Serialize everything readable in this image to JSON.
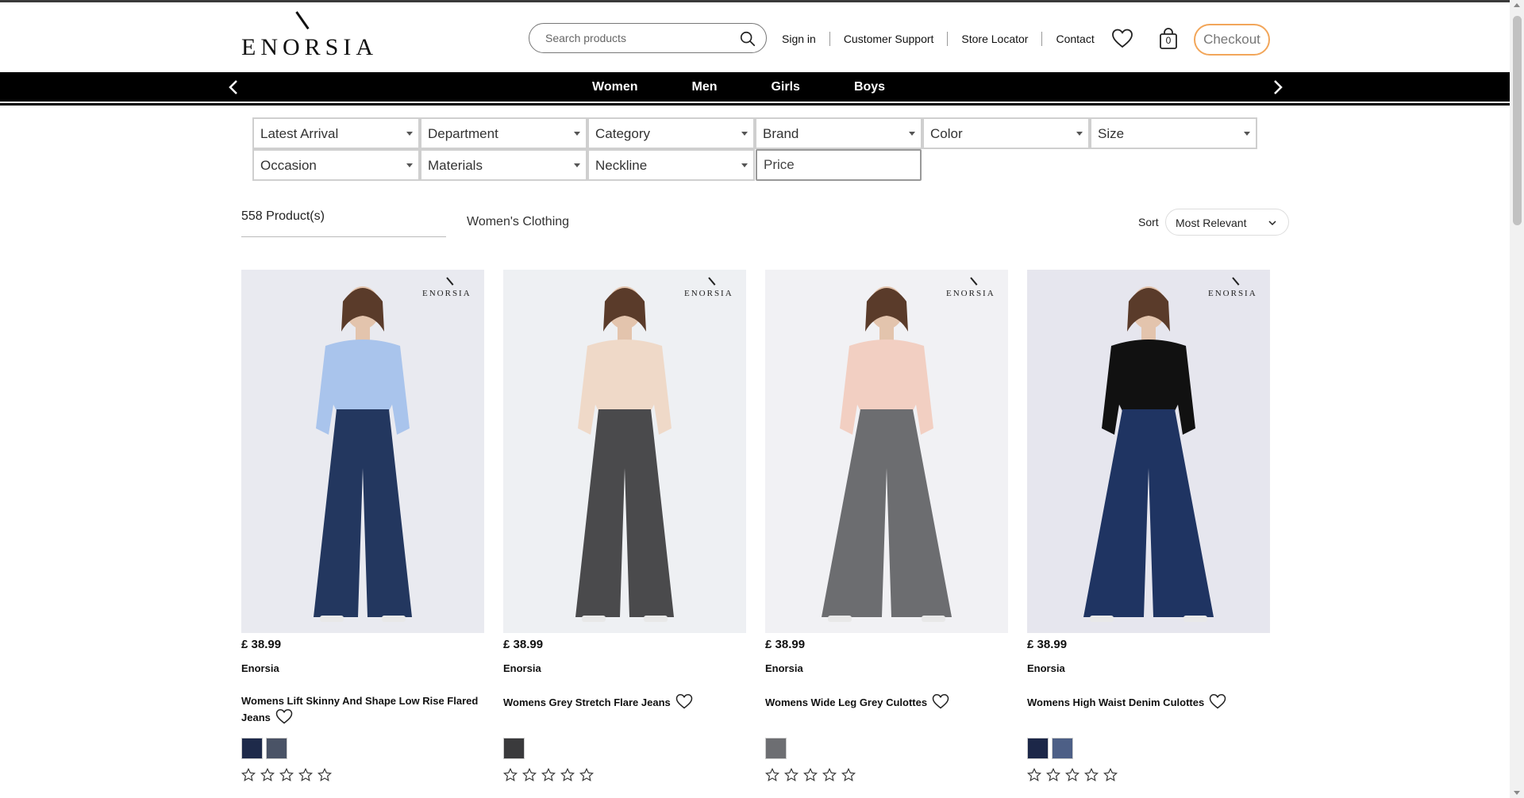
{
  "brand_logo": "ENORSIA",
  "search": {
    "placeholder": "Search products"
  },
  "toplinks": [
    "Sign in",
    "Customer Support",
    "Store Locator",
    "Contact"
  ],
  "bag_count": "0",
  "checkout_label": "Checkout",
  "nav": [
    "Women",
    "Men",
    "Girls",
    "Boys"
  ],
  "filters": {
    "row1": [
      "Latest Arrival",
      "Department",
      "Category",
      "Brand",
      "Color",
      "Size"
    ],
    "row2": [
      "Occasion",
      "Materials",
      "Neckline"
    ],
    "price_placeholder": "Price"
  },
  "results": {
    "count": "558 Product(s)",
    "breadcrumb": "Women's Clothing",
    "sort_label": "Sort",
    "sort_value": "Most Relevant"
  },
  "products": [
    {
      "price": "£ 38.99",
      "brand": "Enorsia",
      "title": "Womens Lift Skinny And Shape Low Rise Flared Jeans",
      "swatches": [
        "#1e2a4a",
        "#4a5366"
      ],
      "top_color": "#a9c4ec",
      "bottom_color": "#23375f",
      "bg_color": "#e9eaf0"
    },
    {
      "price": "£ 38.99",
      "brand": "Enorsia",
      "title": "Womens Grey Stretch Flare Jeans",
      "swatches": [
        "#3a3a3c"
      ],
      "top_color": "#efd9c8",
      "bottom_color": "#4a4a4c",
      "bg_color": "#eef0f3"
    },
    {
      "price": "£ 38.99",
      "brand": "Enorsia",
      "title": "Womens Wide Leg Grey Culottes",
      "swatches": [
        "#6d6e72"
      ],
      "top_color": "#f2cfc2",
      "bottom_color": "#6c6d70",
      "bg_color": "#f1f1f4"
    },
    {
      "price": "£ 38.99",
      "brand": "Enorsia",
      "title": "Womens High Waist Denim Culottes",
      "swatches": [
        "#1c2748",
        "#4d5f86"
      ],
      "top_color": "#111111",
      "bottom_color": "#1f3462",
      "bg_color": "#e6e6ee"
    }
  ],
  "colors": {
    "checkout_border": "#f2a65a",
    "nav_bg": "#000000"
  }
}
